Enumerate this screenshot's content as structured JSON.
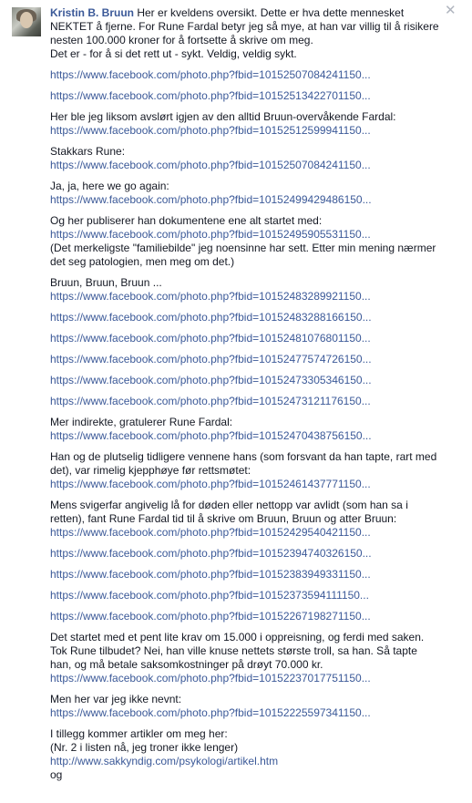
{
  "comment": {
    "author": "Kristin B. Bruun",
    "intro_line1": "Her er kveldens oversikt. Dette er hva dette mennesket",
    "intro_line2": "NEKTET å fjerne. For Rune Fardal betyr jeg så mye, at han var villig til å risikere",
    "intro_line3": "nesten 100.000 kroner for å fortsette å skrive om meg.",
    "intro_line4": "Det er - for å si det rett ut - sykt. Veldig, veldig sykt.",
    "link1": "https://www.facebook.com/photo.php?fbid=10152507084241150...",
    "link2": "https://www.facebook.com/photo.php?fbid=10152513422701150...",
    "p_fardal": "Her ble jeg liksom avslørt igjen av den alltid Bruun-overvåkende Fardal:",
    "link3": "https://www.facebook.com/photo.php?fbid=10152512599941150...",
    "p_stakkars": "Stakkars Rune:",
    "link4": "https://www.facebook.com/photo.php?fbid=10152507084241150...",
    "p_jaja": "Ja, ja, here we go again:",
    "link5": "https://www.facebook.com/photo.php?fbid=10152499429486150...",
    "p_publiserer": "Og her publiserer han dokumentene ene alt startet med:",
    "link6": "https://www.facebook.com/photo.php?fbid=10152495905531150...",
    "p_merkelig1": "(Det merkeligste \"familiebilde\" jeg noensinne har sett. Etter min mening nærmer",
    "p_merkelig2": "det seg patologien, men meg om det.)",
    "p_bruun": "Bruun, Bruun, Bruun ...",
    "link7": "https://www.facebook.com/photo.php?fbid=10152483289921150...",
    "link8": "https://www.facebook.com/photo.php?fbid=10152483288166150...",
    "link9": "https://www.facebook.com/photo.php?fbid=10152481076801150...",
    "link10": "https://www.facebook.com/photo.php?fbid=10152477574726150...",
    "link11": "https://www.facebook.com/photo.php?fbid=10152473305346150...",
    "link12": "https://www.facebook.com/photo.php?fbid=10152473121176150...",
    "p_indirekte": "Mer indirekte, gratulerer Rune Fardal:",
    "link13": "https://www.facebook.com/photo.php?fbid=10152470438756150...",
    "p_vennene1": "Han og de plutselig tidligere vennene hans (som forsvant da han tapte, rart med",
    "p_vennene2": "det), var rimelig kjepphøye før rettsmøtet:",
    "link14": "https://www.facebook.com/photo.php?fbid=10152461437771150...",
    "p_svigerfar1": "Mens svigerfar angivelig lå for døden eller nettopp var avlidt (som han sa i",
    "p_svigerfar2": "retten), fant Rune Fardal tid til å skrive om Bruun, Bruun og atter Bruun:",
    "link15": "https://www.facebook.com/photo.php?fbid=10152429540421150...",
    "link16": "https://www.facebook.com/photo.php?fbid=10152394740326150...",
    "link17": "https://www.facebook.com/photo.php?fbid=10152383949331150...",
    "link18": "https://www.facebook.com/photo.php?fbid=10152373594111150...",
    "link19": "https://www.facebook.com/photo.php?fbid=10152267198271150...",
    "p_krav1": "Det startet med et pent lite krav om 15.000 i oppreisning, og ferdi med saken.",
    "p_krav2": "Tok Rune tilbudet? Nei, han ville knuse nettets største troll, sa han. Så tapte",
    "p_krav3": "han, og må betale saksomkostninger på drøyt 70.000 kr.",
    "link20": "https://www.facebook.com/photo.php?fbid=10152237017751150...",
    "p_ikkenevnt": "Men her var jeg ikke nevnt:",
    "link21": "https://www.facebook.com/photo.php?fbid=10152225597341150...",
    "p_artikler1": "I tillegg kommer artikler om meg her:",
    "p_artikler2": "(Nr. 2 i listen nå, jeg troner ikke lenger)",
    "link22": "http://www.sakkyndig.com/psykologi/artikel.htm",
    "p_og": "og"
  },
  "icons": {
    "close": "close-icon",
    "avatar": "avatar"
  },
  "colors": {
    "link": "#3b5998",
    "text": "#141823",
    "close": "#b0b5bf"
  }
}
